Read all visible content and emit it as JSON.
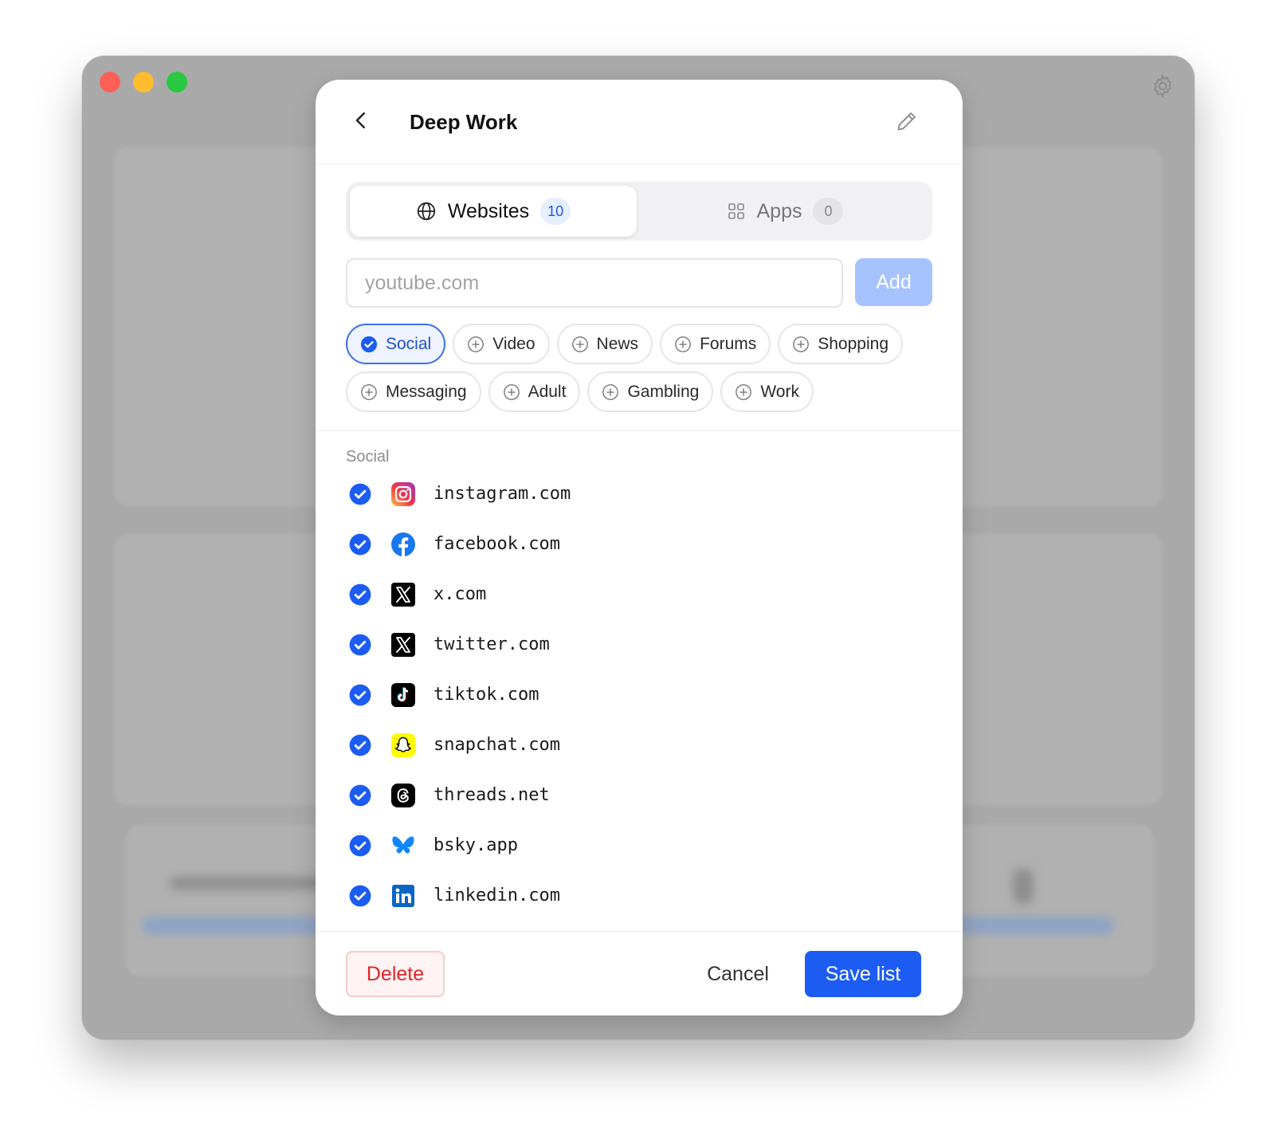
{
  "colors": {
    "accent": "#1c5cf2",
    "danger": "#e0252a",
    "add_disabled": "#a7c3ff"
  },
  "window": {
    "controls": [
      "close",
      "minimize",
      "zoom"
    ]
  },
  "modal": {
    "title": "Deep Work",
    "tabs": [
      {
        "label": "Websites",
        "count": "10",
        "icon": "globe-icon",
        "selected": true
      },
      {
        "label": "Apps",
        "count": "0",
        "icon": "grid-icon",
        "selected": false
      }
    ],
    "input": {
      "placeholder": "youtube.com",
      "value": ""
    },
    "add_label": "Add",
    "categories": [
      {
        "label": "Social",
        "selected": true
      },
      {
        "label": "Video",
        "selected": false
      },
      {
        "label": "News",
        "selected": false
      },
      {
        "label": "Forums",
        "selected": false
      },
      {
        "label": "Shopping",
        "selected": false
      },
      {
        "label": "Messaging",
        "selected": false
      },
      {
        "label": "Adult",
        "selected": false
      },
      {
        "label": "Gambling",
        "selected": false
      },
      {
        "label": "Work",
        "selected": false
      }
    ],
    "section_label": "Social",
    "sites": [
      {
        "name": "instagram.com",
        "icon": "instagram-icon",
        "checked": true
      },
      {
        "name": "facebook.com",
        "icon": "facebook-icon",
        "checked": true
      },
      {
        "name": "x.com",
        "icon": "x-icon",
        "checked": true
      },
      {
        "name": "twitter.com",
        "icon": "x-icon",
        "checked": true
      },
      {
        "name": "tiktok.com",
        "icon": "tiktok-icon",
        "checked": true
      },
      {
        "name": "snapchat.com",
        "icon": "snapchat-icon",
        "checked": true
      },
      {
        "name": "threads.net",
        "icon": "threads-icon",
        "checked": true
      },
      {
        "name": "bsky.app",
        "icon": "bluesky-icon",
        "checked": true
      },
      {
        "name": "linkedin.com",
        "icon": "linkedin-icon",
        "checked": true
      }
    ],
    "footer": {
      "delete_label": "Delete",
      "cancel_label": "Cancel",
      "save_label": "Save list"
    }
  }
}
